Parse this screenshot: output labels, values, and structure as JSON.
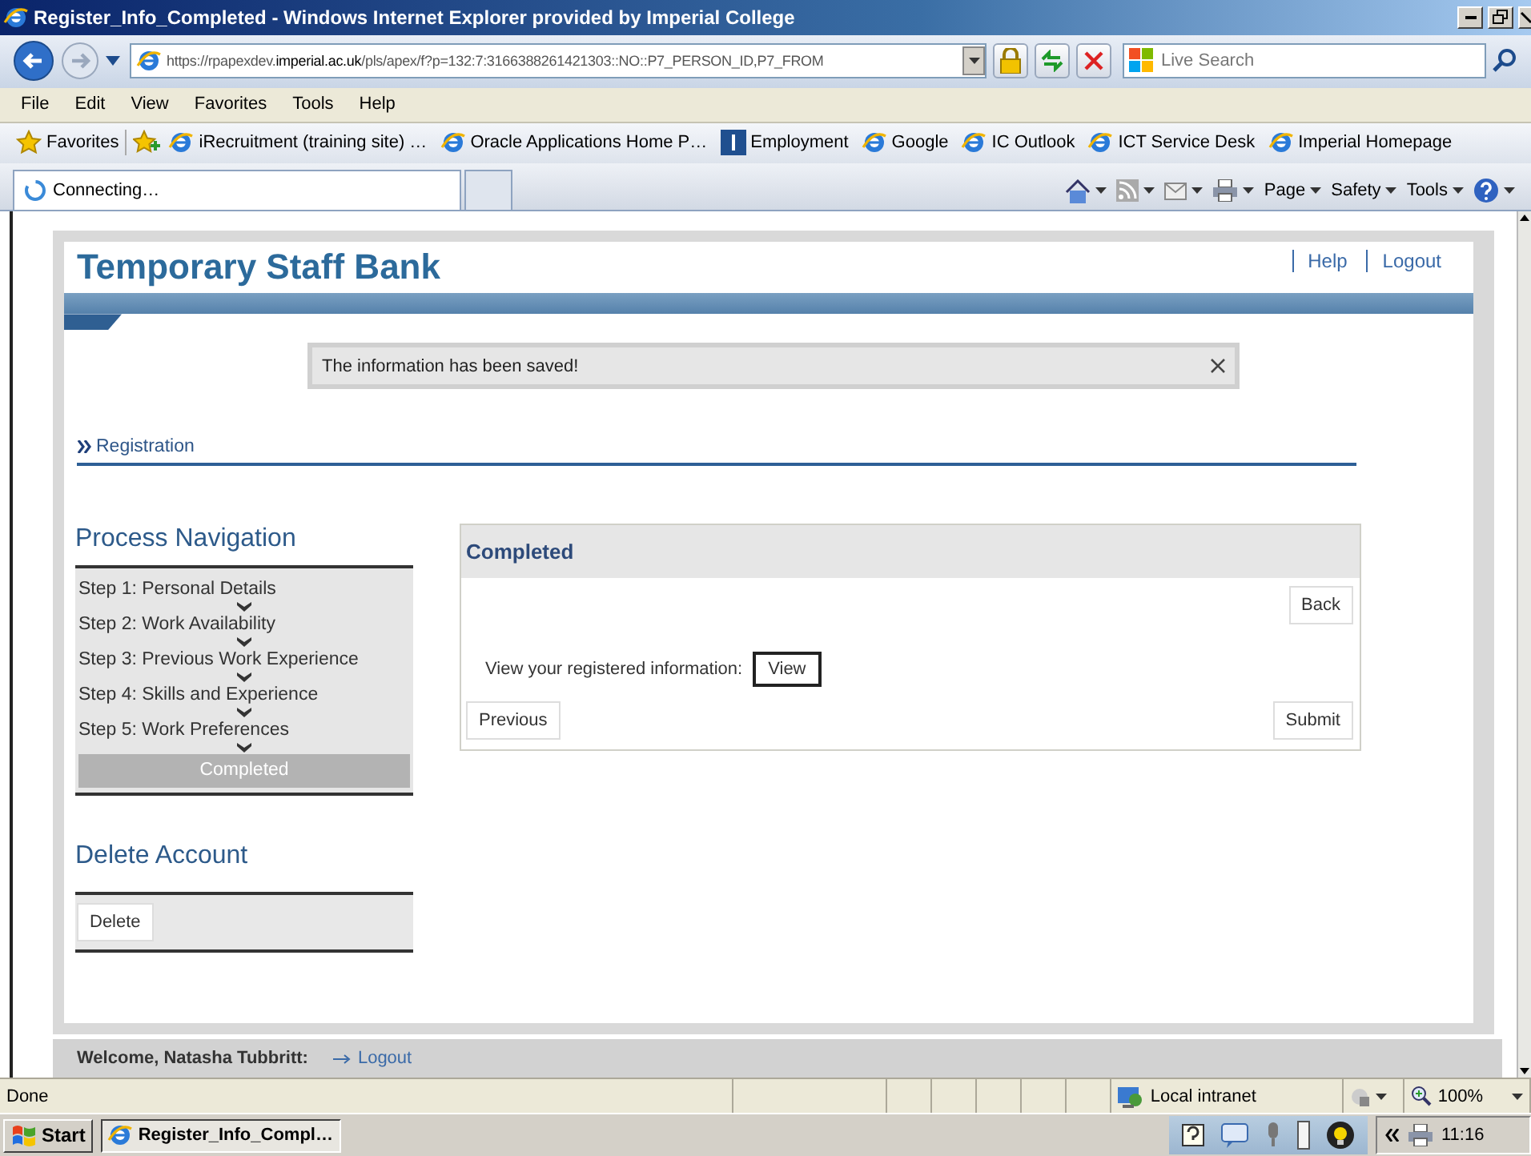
{
  "window": {
    "title": "Register_Info_Completed - Windows Internet Explorer provided by Imperial College"
  },
  "address_bar": {
    "url": "https://rpapexdev.**imperial.ac.uk**/pls/apex/f?p=132:7:3166388261421303::NO::P7_PERSON_ID,P7_FROM"
  },
  "search": {
    "placeholder": "Live Search"
  },
  "menu": [
    "File",
    "Edit",
    "View",
    "Favorites",
    "Tools",
    "Help"
  ],
  "favorites": {
    "label": "Favorites",
    "links": [
      {
        "label": "iRecruitment (training site) …",
        "kind": "page"
      },
      {
        "label": "Oracle Applications Home P…",
        "kind": "page"
      },
      {
        "label": "Employment",
        "kind": "site"
      },
      {
        "label": "Google",
        "kind": "page"
      },
      {
        "label": "IC Outlook",
        "kind": "page"
      },
      {
        "label": "ICT Service Desk",
        "kind": "page"
      },
      {
        "label": "Imperial Homepage",
        "kind": "page"
      }
    ]
  },
  "tabs": [
    {
      "label": "Connecting…",
      "selected": true
    },
    {
      "selected": false
    }
  ],
  "commands": [
    "Page",
    "Safety",
    "Tools"
  ],
  "site": {
    "title": "Temporary Staff Bank",
    "links": [
      "Help",
      "Logout"
    ],
    "message": "The information has been saved!",
    "breadcrumb": "Registration",
    "process_nav": {
      "title": "Process Navigation",
      "steps": [
        {
          "label": "Step 1: Personal Details",
          "selected": false
        },
        {
          "label": "Step 2: Work Availability",
          "selected": false
        },
        {
          "label": "Step 3: Previous Work Experience",
          "selected": false
        },
        {
          "label": "Step 4: Skills and Experience",
          "selected": false
        },
        {
          "label": "Step 5: Work Preferences",
          "selected": false
        },
        {
          "label": "Completed",
          "selected": true
        }
      ]
    },
    "delete_account": {
      "title": "Delete Account",
      "button": "Delete"
    },
    "region": {
      "title": "Completed",
      "back": "Back",
      "prompt": "View your registered information:",
      "view": "View",
      "previous": "Previous",
      "submit": "Submit"
    },
    "footer": {
      "welcome": "Welcome, Natasha Tubbritt:",
      "logout": "Logout"
    }
  },
  "status_bar": {
    "text": "Done",
    "zone": "Local intranet",
    "zoom": "100%"
  },
  "taskbar": {
    "start": "Start",
    "tasks": [
      {
        "label": "Register_Info_Compl…",
        "selected": true
      }
    ],
    "clock": "11:16"
  }
}
